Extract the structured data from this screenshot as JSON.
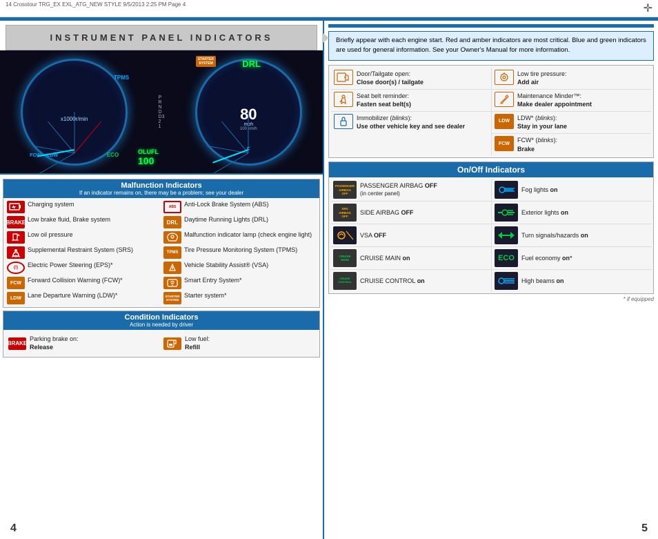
{
  "page": {
    "header_left": "14 Crosstour TRG_EX EXL_ATG_NEW STYLE  9/5/2013  2:25 PM  Page 4",
    "page_num_left": "4",
    "page_num_right": "5",
    "footnote": "* if equipped"
  },
  "left_panel": {
    "title": "INSTRUMENT PANEL INDICATORS",
    "info_text": "Briefly appear with each engine start. Red and amber indicators are most critical. Blue and green indicators are used for general information. See your Owner's Manual for more information.",
    "malfunction_section": {
      "header": "Malfunction Indicators",
      "subheader": "If an indicator remains on, there may be a problem; see your dealer",
      "items": [
        {
          "icon": "charging-icon",
          "label": "Charging system"
        },
        {
          "icon": "brake-icon",
          "label": "Low brake fluid, Brake system"
        },
        {
          "icon": "oil-icon",
          "label": "Low oil pressure"
        },
        {
          "icon": "srs-icon",
          "label": "Supplemental Restraint System (SRS)"
        },
        {
          "icon": "eps-icon",
          "label": "Electric Power Steering (EPS)*"
        },
        {
          "icon": "fcw-icon",
          "label": "Forward Collision Warning (FCW)*"
        },
        {
          "icon": "ldw-icon",
          "label": "Lane Departure Warning (LDW)*"
        },
        {
          "icon": "abs-icon",
          "label": "Anti-Lock Brake System (ABS)"
        },
        {
          "icon": "drl-icon",
          "label": "Daytime Running Lights (DRL)"
        },
        {
          "icon": "mil-icon",
          "label": "Malfunction indicator lamp (check engine light)"
        },
        {
          "icon": "tpms-icon",
          "label": "Tire Pressure Monitoring System (TPMS)"
        },
        {
          "icon": "vsa-icon",
          "label": "Vehicle Stability Assist® (VSA)"
        },
        {
          "icon": "smart-icon",
          "label": "Smart Entry System*"
        },
        {
          "icon": "starter-icon",
          "label": "Starter system*"
        }
      ]
    },
    "condition_section": {
      "header": "Condition Indicators",
      "subheader": "Action is needed by driver",
      "items": [
        {
          "icon": "brake-condition-icon",
          "label": "Parking brake on:",
          "sublabel": "Release"
        },
        {
          "icon": "fuel-icon",
          "label": "Low fuel:",
          "sublabel": "Refill"
        }
      ]
    }
  },
  "right_panel": {
    "info_items": [
      {
        "icon": "door-icon",
        "label": "Door/Tailgate open:",
        "action": "Close door(s) / tailgate"
      },
      {
        "icon": "seatbelt-icon",
        "label": "Seat belt reminder:",
        "action": "Fasten seat belt(s)"
      },
      {
        "icon": "immobilizer-icon",
        "label": "Immobilizer (blinks):",
        "action": "Use other vehicle key and see dealer"
      },
      {
        "icon": "tire-pressure-icon",
        "label": "Low tire pressure:",
        "action": "Add air"
      },
      {
        "icon": "maintenance-icon",
        "label": "Maintenance Minder™:",
        "action": "Make dealer appointment"
      },
      {
        "icon": "ldw-info-icon",
        "label": "LDW* (blinks):",
        "action": "Stay in your lane"
      },
      {
        "icon": "fcw-info-icon",
        "label": "FCW* (blinks):",
        "action": "Brake"
      }
    ],
    "on_off_section": {
      "header": "On/Off Indicators",
      "items": [
        {
          "icon": "passenger-airbag-icon",
          "label": "PASSENGER AIRBAG ",
          "emphasis": "OFF",
          "note": "(in center panel)"
        },
        {
          "icon": "fog-icon",
          "label": "Fog lights ",
          "emphasis": "on"
        },
        {
          "icon": "side-airbag-icon",
          "label": "SIDE AIRBAG ",
          "emphasis": "OFF"
        },
        {
          "icon": "exterior-icon",
          "label": "Exterior lights ",
          "emphasis": "on"
        },
        {
          "icon": "vsa-off-icon",
          "label": "VSA ",
          "emphasis": "OFF"
        },
        {
          "icon": "turn-signals-icon",
          "label": "Turn signals/hazards ",
          "emphasis": "on"
        },
        {
          "icon": "cruise-main-icon",
          "label": "CRUISE MAIN ",
          "emphasis": "on"
        },
        {
          "icon": "fuel-economy-icon",
          "label": "Fuel economy ",
          "emphasis": "on°"
        },
        {
          "icon": "cruise-control-icon",
          "label": "CRUISE CONTROL ",
          "emphasis": "on"
        },
        {
          "icon": "high-beams-icon",
          "label": "High beams ",
          "emphasis": "on"
        }
      ]
    }
  }
}
